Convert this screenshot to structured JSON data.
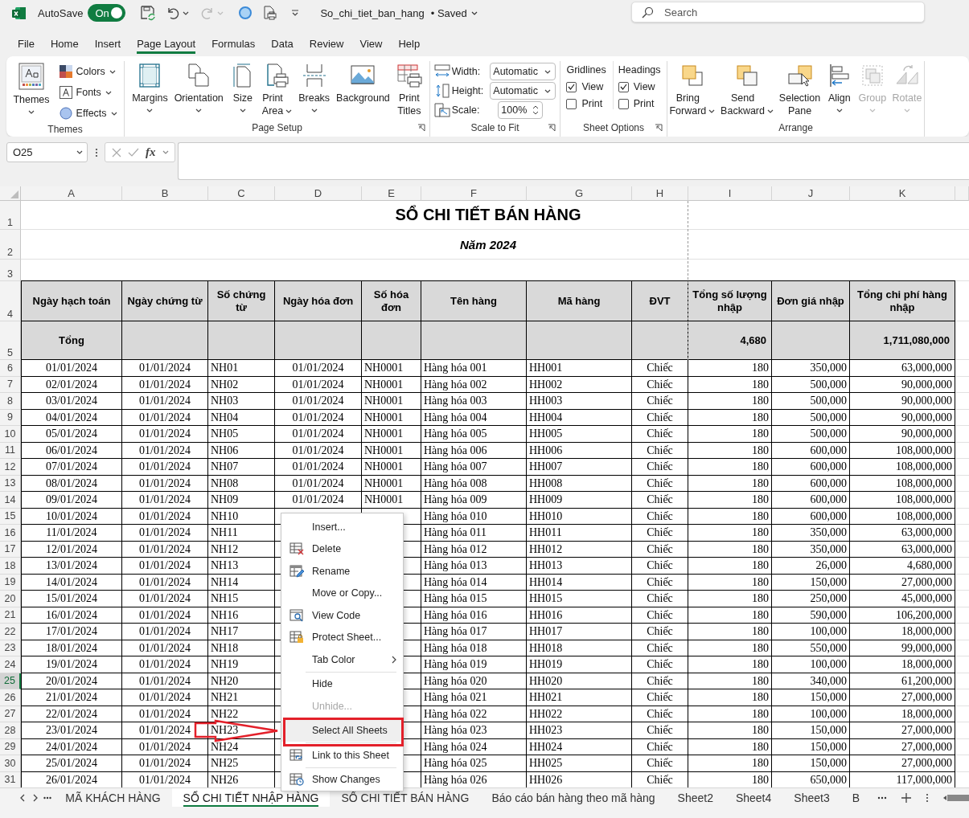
{
  "title_bar": {
    "autosave_label": "AutoSave",
    "autosave": {
      "label": "On",
      "on": true
    },
    "document_name": "So_chi_tiet_ban_hang",
    "save_status": "• Saved",
    "search": {
      "placeholder": "Search"
    }
  },
  "menu_tabs": [
    {
      "label": "File",
      "selected": false
    },
    {
      "label": "Home",
      "selected": false
    },
    {
      "label": "Insert",
      "selected": false
    },
    {
      "label": "Page Layout",
      "selected": true
    },
    {
      "label": "Formulas",
      "selected": false
    },
    {
      "label": "Data",
      "selected": false
    },
    {
      "label": "Review",
      "selected": false
    },
    {
      "label": "View",
      "selected": false
    },
    {
      "label": "Help",
      "selected": false
    }
  ],
  "ribbon": {
    "groups": [
      {
        "label": "Themes",
        "launcher": false,
        "items": [
          {
            "kind": "large",
            "label": "Themes",
            "dropdown": true,
            "disabled": false
          },
          {
            "kind": "small",
            "label": "Colors",
            "dropdown": true,
            "disabled": false
          },
          {
            "kind": "small",
            "label": "Fonts",
            "dropdown": true,
            "disabled": false
          },
          {
            "kind": "small",
            "label": "Effects",
            "dropdown": true,
            "disabled": false
          }
        ]
      },
      {
        "label": "Page Setup",
        "launcher": true,
        "items": [
          {
            "kind": "large",
            "label": "Margins",
            "dropdown": true,
            "disabled": false
          },
          {
            "kind": "large",
            "label": "Orientation",
            "dropdown": true,
            "disabled": false
          },
          {
            "kind": "large",
            "label": "Size",
            "dropdown": true,
            "disabled": false
          },
          {
            "kind": "large",
            "label": "Print\nArea",
            "dropdown": true,
            "disabled": false
          },
          {
            "kind": "large",
            "label": "Breaks",
            "dropdown": true,
            "disabled": false
          },
          {
            "kind": "large",
            "label": "Background",
            "dropdown": false,
            "disabled": false
          },
          {
            "kind": "large",
            "label": "Print\nTitles",
            "dropdown": false,
            "disabled": false
          }
        ]
      },
      {
        "label": "Scale to Fit",
        "launcher": true,
        "items": [
          {
            "kind": "dropdown",
            "label": "Width:",
            "value": "Automatic"
          },
          {
            "kind": "dropdown",
            "label": "Height:",
            "value": "Automatic"
          },
          {
            "kind": "spinner",
            "label": "Scale:",
            "value": "100%"
          }
        ]
      },
      {
        "label": "Sheet Options",
        "launcher": true,
        "items": [
          {
            "kind": "options",
            "title": "Gridlines",
            "options": [
              {
                "label": "View",
                "checked": true
              },
              {
                "label": "Print",
                "checked": false
              }
            ]
          },
          {
            "kind": "options",
            "title": "Headings",
            "options": [
              {
                "label": "View",
                "checked": true
              },
              {
                "label": "Print",
                "checked": false
              }
            ]
          }
        ]
      },
      {
        "label": "Arrange",
        "launcher": false,
        "items": [
          {
            "kind": "large",
            "label": "Bring\nForward",
            "dropdown": true,
            "disabled": false
          },
          {
            "kind": "large",
            "label": "Send\nBackward",
            "dropdown": true,
            "disabled": false
          },
          {
            "kind": "large",
            "label": "Selection\nPane",
            "dropdown": false,
            "disabled": false
          },
          {
            "kind": "large",
            "label": "Align",
            "dropdown": true,
            "disabled": false
          },
          {
            "kind": "large",
            "label": "Group",
            "dropdown": true,
            "disabled": true
          },
          {
            "kind": "large",
            "label": "Rotate",
            "dropdown": true,
            "disabled": true
          }
        ]
      }
    ]
  },
  "formula_bar": {
    "name_box": "O25",
    "function_label": "fx"
  },
  "sheet": {
    "columns": [
      "A",
      "B",
      "C",
      "D",
      "E",
      "F",
      "G",
      "H",
      "I",
      "J",
      "K"
    ],
    "top_row_numbers": [
      "1",
      "2",
      "3",
      "4",
      "5"
    ],
    "title": "SỔ CHI TIẾT BÁN HÀNG",
    "subtitle": "Năm 2024",
    "header": [
      "Ngày hạch toán",
      "Ngày chứng từ",
      "Số chứng từ",
      "Ngày hóa đơn",
      "Số hóa đơn",
      "Tên hàng",
      "Mã hàng",
      "ĐVT",
      "Tổng số lượng nhập",
      "Đơn giá nhập",
      "Tổng chi phí hàng nhập"
    ],
    "totals": {
      "label": "Tổng",
      "quantity": "4,680",
      "amount": "1,711,080,000"
    },
    "rows": [
      {
        "number": "6",
        "active": false,
        "cells": [
          "01/01/2024",
          "01/01/2024",
          "NH01",
          "01/01/2024",
          "NH0001",
          "Hàng hóa 001",
          "HH001",
          "Chiếc",
          "180",
          "350,000",
          "63,000,000"
        ]
      },
      {
        "number": "7",
        "active": false,
        "cells": [
          "02/01/2024",
          "01/01/2024",
          "NH02",
          "01/01/2024",
          "NH0001",
          "Hàng hóa 002",
          "HH002",
          "Chiếc",
          "180",
          "500,000",
          "90,000,000"
        ]
      },
      {
        "number": "8",
        "active": false,
        "cells": [
          "03/01/2024",
          "01/01/2024",
          "NH03",
          "01/01/2024",
          "NH0001",
          "Hàng hóa 003",
          "HH003",
          "Chiếc",
          "180",
          "500,000",
          "90,000,000"
        ]
      },
      {
        "number": "9",
        "active": false,
        "cells": [
          "04/01/2024",
          "01/01/2024",
          "NH04",
          "01/01/2024",
          "NH0001",
          "Hàng hóa 004",
          "HH004",
          "Chiếc",
          "180",
          "500,000",
          "90,000,000"
        ]
      },
      {
        "number": "10",
        "active": false,
        "cells": [
          "05/01/2024",
          "01/01/2024",
          "NH05",
          "01/01/2024",
          "NH0001",
          "Hàng hóa 005",
          "HH005",
          "Chiếc",
          "180",
          "500,000",
          "90,000,000"
        ]
      },
      {
        "number": "11",
        "active": false,
        "cells": [
          "06/01/2024",
          "01/01/2024",
          "NH06",
          "01/01/2024",
          "NH0001",
          "Hàng hóa 006",
          "HH006",
          "Chiếc",
          "180",
          "600,000",
          "108,000,000"
        ]
      },
      {
        "number": "12",
        "active": false,
        "cells": [
          "07/01/2024",
          "01/01/2024",
          "NH07",
          "01/01/2024",
          "NH0001",
          "Hàng hóa 007",
          "HH007",
          "Chiếc",
          "180",
          "600,000",
          "108,000,000"
        ]
      },
      {
        "number": "13",
        "active": false,
        "cells": [
          "08/01/2024",
          "01/01/2024",
          "NH08",
          "01/01/2024",
          "NH0001",
          "Hàng hóa 008",
          "HH008",
          "Chiếc",
          "180",
          "600,000",
          "108,000,000"
        ]
      },
      {
        "number": "14",
        "active": false,
        "cells": [
          "09/01/2024",
          "01/01/2024",
          "NH09",
          "01/01/2024",
          "NH0001",
          "Hàng hóa 009",
          "HH009",
          "Chiếc",
          "180",
          "600,000",
          "108,000,000"
        ]
      },
      {
        "number": "15",
        "active": false,
        "cells": [
          "10/01/2024",
          "01/01/2024",
          "NH10",
          null,
          null,
          "Hàng hóa 010",
          "HH010",
          "Chiếc",
          "180",
          "600,000",
          "108,000,000"
        ]
      },
      {
        "number": "16",
        "active": false,
        "cells": [
          "11/01/2024",
          "01/01/2024",
          "NH11",
          null,
          null,
          "Hàng hóa 011",
          "HH011",
          "Chiếc",
          "180",
          "350,000",
          "63,000,000"
        ]
      },
      {
        "number": "17",
        "active": false,
        "cells": [
          "12/01/2024",
          "01/01/2024",
          "NH12",
          null,
          null,
          "Hàng hóa 012",
          "HH012",
          "Chiếc",
          "180",
          "350,000",
          "63,000,000"
        ]
      },
      {
        "number": "18",
        "active": false,
        "cells": [
          "13/01/2024",
          "01/01/2024",
          "NH13",
          null,
          null,
          "Hàng hóa 013",
          "HH013",
          "Chiếc",
          "180",
          "26,000",
          "4,680,000"
        ]
      },
      {
        "number": "19",
        "active": false,
        "cells": [
          "14/01/2024",
          "01/01/2024",
          "NH14",
          null,
          null,
          "Hàng hóa 014",
          "HH014",
          "Chiếc",
          "180",
          "150,000",
          "27,000,000"
        ]
      },
      {
        "number": "20",
        "active": false,
        "cells": [
          "15/01/2024",
          "01/01/2024",
          "NH15",
          null,
          null,
          "Hàng hóa 015",
          "HH015",
          "Chiếc",
          "180",
          "250,000",
          "45,000,000"
        ]
      },
      {
        "number": "21",
        "active": false,
        "cells": [
          "16/01/2024",
          "01/01/2024",
          "NH16",
          null,
          null,
          "Hàng hóa 016",
          "HH016",
          "Chiếc",
          "180",
          "590,000",
          "106,200,000"
        ]
      },
      {
        "number": "22",
        "active": false,
        "cells": [
          "17/01/2024",
          "01/01/2024",
          "NH17",
          null,
          null,
          "Hàng hóa 017",
          "HH017",
          "Chiếc",
          "180",
          "100,000",
          "18,000,000"
        ]
      },
      {
        "number": "23",
        "active": false,
        "cells": [
          "18/01/2024",
          "01/01/2024",
          "NH18",
          null,
          null,
          "Hàng hóa 018",
          "HH018",
          "Chiếc",
          "180",
          "550,000",
          "99,000,000"
        ]
      },
      {
        "number": "24",
        "active": false,
        "cells": [
          "19/01/2024",
          "01/01/2024",
          "NH19",
          null,
          null,
          "Hàng hóa 019",
          "HH019",
          "Chiếc",
          "180",
          "100,000",
          "18,000,000"
        ]
      },
      {
        "number": "25",
        "active": true,
        "cells": [
          "20/01/2024",
          "01/01/2024",
          "NH20",
          null,
          null,
          "Hàng hóa 020",
          "HH020",
          "Chiếc",
          "180",
          "340,000",
          "61,200,000"
        ]
      },
      {
        "number": "26",
        "active": false,
        "cells": [
          "21/01/2024",
          "01/01/2024",
          "NH21",
          null,
          null,
          "Hàng hóa 021",
          "HH021",
          "Chiếc",
          "180",
          "150,000",
          "27,000,000"
        ]
      },
      {
        "number": "27",
        "active": false,
        "cells": [
          "22/01/2024",
          "01/01/2024",
          "NH22",
          null,
          null,
          "Hàng hóa 022",
          "HH022",
          "Chiếc",
          "180",
          "100,000",
          "18,000,000"
        ]
      },
      {
        "number": "28",
        "active": false,
        "cells": [
          "23/01/2024",
          "01/01/2024",
          "NH23",
          null,
          null,
          "Hàng hóa 023",
          "HH023",
          "Chiếc",
          "180",
          "150,000",
          "27,000,000"
        ]
      },
      {
        "number": "29",
        "active": false,
        "cells": [
          "24/01/2024",
          "01/01/2024",
          "NH24",
          null,
          null,
          "Hàng hóa 024",
          "HH024",
          "Chiếc",
          "180",
          "150,000",
          "27,000,000"
        ]
      },
      {
        "number": "30",
        "active": false,
        "cells": [
          "25/01/2024",
          "01/01/2024",
          "NH25",
          null,
          null,
          "Hàng hóa 025",
          "HH025",
          "Chiếc",
          "180",
          "150,000",
          "27,000,000"
        ]
      },
      {
        "number": "31",
        "active": false,
        "cells": [
          "26/01/2024",
          "01/01/2024",
          "NH26",
          null,
          null,
          "Hàng hóa 026",
          "HH026",
          "Chiếc",
          "180",
          "650,000",
          "117,000,000"
        ]
      }
    ]
  },
  "context_menu": [
    {
      "label": "Insert...",
      "kind": "item",
      "disabled": false,
      "highlighted": false,
      "separator_before": false
    },
    {
      "label": "Delete",
      "kind": "item",
      "disabled": false,
      "highlighted": false,
      "separator_before": false
    },
    {
      "label": "Rename",
      "kind": "item",
      "disabled": false,
      "highlighted": false,
      "separator_before": false
    },
    {
      "label": "Move or Copy...",
      "kind": "item",
      "disabled": false,
      "highlighted": false,
      "separator_before": false
    },
    {
      "label": "View Code",
      "kind": "item",
      "disabled": false,
      "highlighted": false,
      "separator_before": false
    },
    {
      "label": "Protect Sheet...",
      "kind": "item",
      "disabled": false,
      "highlighted": false,
      "separator_before": false
    },
    {
      "label": "Tab Color",
      "kind": "submenu",
      "disabled": false,
      "highlighted": false,
      "separator_before": false
    },
    {
      "label": "Hide",
      "kind": "item",
      "disabled": false,
      "highlighted": false,
      "separator_before": true
    },
    {
      "label": "Unhide...",
      "kind": "item",
      "disabled": true,
      "highlighted": false,
      "separator_before": false
    },
    {
      "label": "Select All Sheets",
      "kind": "item",
      "disabled": false,
      "highlighted": true,
      "separator_before": true
    },
    {
      "label": "Link to this Sheet",
      "kind": "item",
      "disabled": false,
      "highlighted": false,
      "separator_before": true
    },
    {
      "label": "Show Changes",
      "kind": "item",
      "disabled": false,
      "highlighted": false,
      "separator_before": true
    }
  ],
  "sheet_tabs": [
    {
      "label": "MÃ KHÁCH HÀNG",
      "selected": false
    },
    {
      "label": "SỔ CHI TIẾT NHẬP HÀNG",
      "selected": true
    },
    {
      "label": "SỔ CHI TIẾT BÁN HÀNG",
      "selected": false
    },
    {
      "label": "Báo cáo bán hàng theo mã hàng",
      "selected": false
    },
    {
      "label": "Sheet2",
      "selected": false
    },
    {
      "label": "Sheet4",
      "selected": false
    },
    {
      "label": "Sheet3",
      "selected": false
    },
    {
      "label": "B",
      "selected": false
    }
  ],
  "annotations": {
    "arrow": true,
    "highlight_box": true
  }
}
